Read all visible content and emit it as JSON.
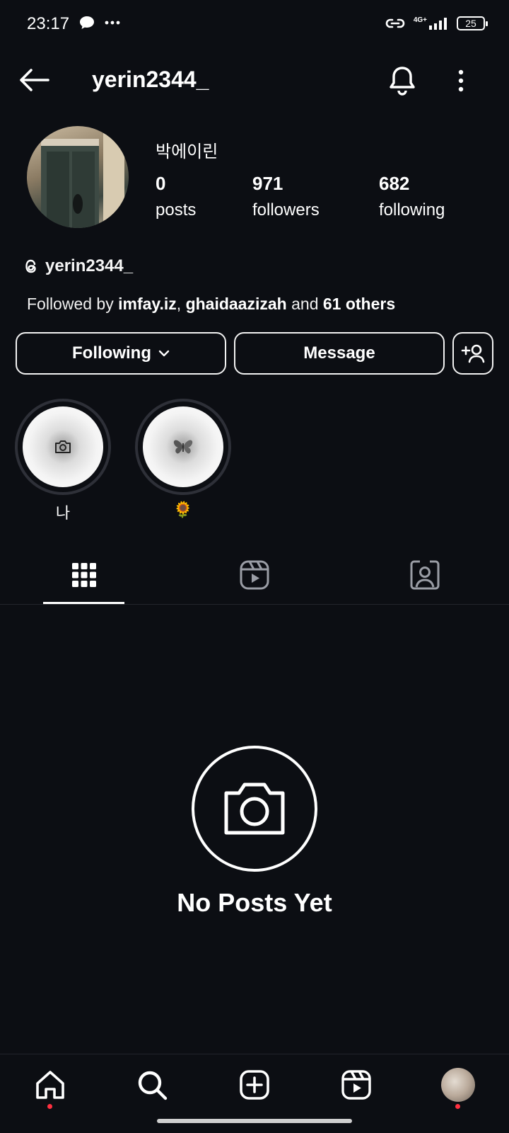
{
  "status_bar": {
    "time": "23:17",
    "network": "4G+",
    "battery": "25",
    "left_icons": [
      "chat-bubble-icon",
      "more-dots-icon"
    ],
    "right_icons": [
      "hotspot-link-icon",
      "signal-icon",
      "battery-icon"
    ]
  },
  "header": {
    "username": "yerin2344_",
    "icons": [
      "back-arrow-icon",
      "bell-icon",
      "more-vertical-icon"
    ]
  },
  "profile": {
    "display_name": "박에이린",
    "stats": [
      {
        "value": "0",
        "label": "posts"
      },
      {
        "value": "971",
        "label": "followers"
      },
      {
        "value": "682",
        "label": "following"
      }
    ],
    "threads_handle": "yerin2344_",
    "followed_by": {
      "prefix": "Followed by ",
      "user1": "imfay.iz",
      "sep": ", ",
      "user2": "ghaidaazizah",
      "conj": " and ",
      "others": "61 others"
    }
  },
  "actions": {
    "following_label": "Following",
    "message_label": "Message"
  },
  "highlights": [
    {
      "label": "나",
      "icon": "camera-icon"
    },
    {
      "label": "🌻",
      "icon": "butterfly-icon"
    }
  ],
  "tabs": [
    {
      "name": "grid",
      "icon": "grid-icon",
      "active": true
    },
    {
      "name": "reels",
      "icon": "reels-icon",
      "active": false
    },
    {
      "name": "tagged",
      "icon": "tagged-person-icon",
      "active": false
    }
  ],
  "empty_state": {
    "title": "No Posts Yet",
    "icon": "camera-icon"
  },
  "bottom_nav": [
    {
      "name": "home",
      "icon": "home-icon",
      "notification_dot": true
    },
    {
      "name": "search",
      "icon": "search-icon",
      "notification_dot": false
    },
    {
      "name": "create",
      "icon": "add-square-icon",
      "notification_dot": false
    },
    {
      "name": "reels",
      "icon": "reels-icon",
      "notification_dot": false
    },
    {
      "name": "profile",
      "icon": "profile-avatar",
      "notification_dot": true
    }
  ],
  "colors": {
    "background": "#0c0e13",
    "text": "#ffffff",
    "notification_dot": "#ff3040",
    "divider": "#23252c"
  }
}
